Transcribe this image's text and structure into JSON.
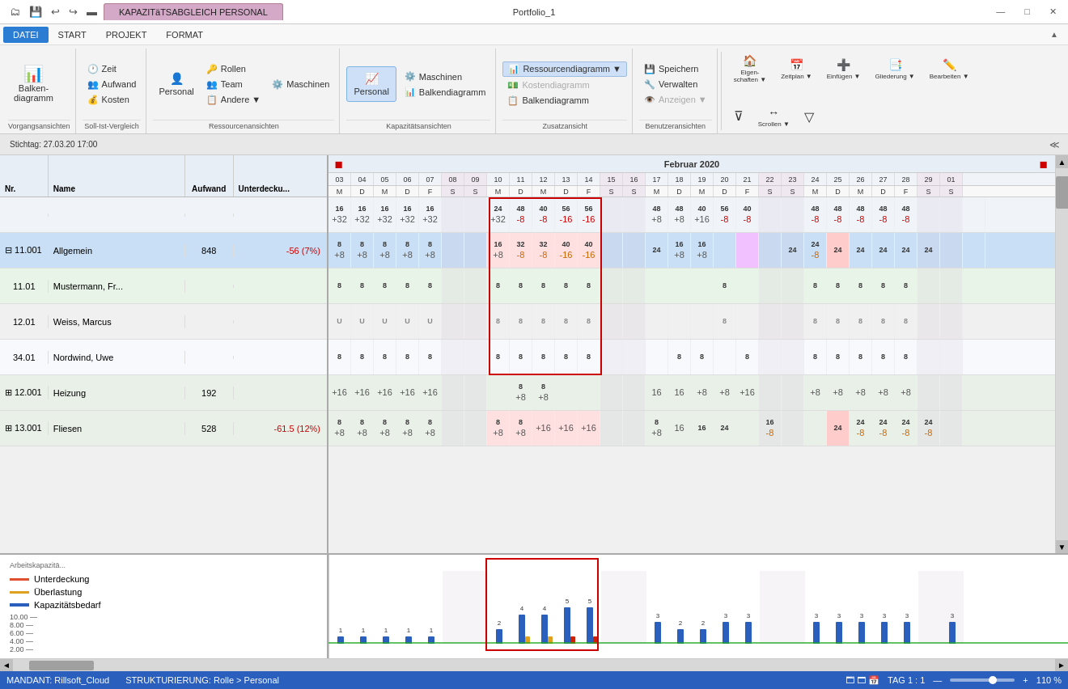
{
  "window": {
    "title": "Portfolio_1",
    "tab_label": "KAPAZITäTSABGLEICH PERSONAL",
    "min": "—",
    "max": "□",
    "close": "✕"
  },
  "menu": {
    "items": [
      "DATEI",
      "START",
      "PROJEKT",
      "FORMAT"
    ]
  },
  "ribbon": {
    "groups": [
      {
        "label": "Vorgangsansichten",
        "buttons": [
          {
            "icon": "📊",
            "label": "Balkendiagramm"
          }
        ]
      },
      {
        "label": "Soll-Ist-Vergleich",
        "buttons": [
          {
            "icon": "🕐",
            "label": "Zeit"
          },
          {
            "icon": "👥",
            "label": "Aufwand"
          },
          {
            "icon": "💰",
            "label": "Kosten"
          }
        ]
      },
      {
        "label": "Ressourcenansichten",
        "buttons": [
          {
            "icon": "👤",
            "label": "Personal"
          },
          {
            "icon": "🔧",
            "label": "Rollen"
          },
          {
            "icon": "👨‍👩‍👧",
            "label": "Team"
          },
          {
            "icon": "⚙️",
            "label": "Maschinen"
          },
          {
            "icon": "📋",
            "label": "Andere"
          }
        ]
      },
      {
        "label": "Kapazitätsansichten",
        "buttons": [
          {
            "icon": "📈",
            "label": "Personal",
            "active": true
          },
          {
            "icon": "📊",
            "label": "Maschinen"
          },
          {
            "icon": "📉",
            "label": "Balkendiagramm"
          }
        ]
      },
      {
        "label": "Zusatzansicht",
        "buttons": [
          {
            "icon": "📊",
            "label": "Ressourcendiagramm",
            "active": true
          },
          {
            "icon": "💵",
            "label": "Kostendiagramm"
          },
          {
            "icon": "📋",
            "label": "Balkendiagramm"
          }
        ]
      },
      {
        "label": "Benutzeransichten",
        "buttons": [
          {
            "icon": "💾",
            "label": "Speichern"
          },
          {
            "icon": "🔧",
            "label": "Verwalten"
          },
          {
            "icon": "👁️",
            "label": "Anzeigen"
          }
        ]
      }
    ],
    "actions": [
      {
        "icon": "🏠",
        "label": "Eigenschaften"
      },
      {
        "icon": "📅",
        "label": "Zeitplan"
      },
      {
        "icon": "➕",
        "label": "Einfügen"
      },
      {
        "icon": "📑",
        "label": "Gliederung"
      },
      {
        "icon": "✏️",
        "label": "Bearbeiten"
      },
      {
        "icon": "🔀",
        "label": "Scrollen"
      }
    ]
  },
  "gantt": {
    "stichtag": "Stichtag: 27.03.20 17:00",
    "month": "Februar 2020",
    "columns": {
      "nr": "Nr.",
      "name": "Name",
      "aufwand": "Aufwand",
      "deckung": "Unterdecku..."
    },
    "rows": [
      {
        "nr": "",
        "name": "",
        "aufwand": "",
        "deckung": "",
        "type": "cap-header",
        "values": [
          "16",
          "16",
          "16",
          "16",
          "16",
          "",
          "",
          "24",
          "48",
          "40",
          "56",
          "56",
          "",
          "",
          "48",
          "48",
          "40",
          "56",
          "40",
          "",
          "",
          "48",
          "48",
          "48",
          "48",
          "48",
          "",
          "",
          ""
        ],
        "sub_values": [
          "+32",
          "+32",
          "+32",
          "+32",
          "+32",
          "",
          "",
          "+32",
          "-8",
          "-8",
          "-16",
          "-16",
          "",
          "",
          "+8",
          "+8",
          "+16",
          "-8",
          "-8",
          "",
          "",
          "-8",
          "-8",
          "-8",
          "-8",
          "-8",
          "",
          "",
          ""
        ]
      },
      {
        "nr": "⊟ 11.001",
        "name": "Allgemein",
        "aufwand": "848",
        "deckung": "-56 (7%)",
        "deckung_neg": true,
        "type": "group",
        "values": [
          "8",
          "8",
          "8",
          "8",
          "8",
          "",
          "",
          "16",
          "32",
          "32",
          "40",
          "40",
          "",
          "",
          "24",
          "16",
          "16",
          "",
          "",
          "",
          "24",
          "24",
          "24",
          "24",
          "24",
          "24",
          "24",
          "",
          ""
        ],
        "sub_values": [
          "+8",
          "+8",
          "+8",
          "+8",
          "+8",
          "",
          "",
          "+8",
          "-8",
          "-8",
          "-16",
          "-16",
          "",
          "",
          "",
          "+8",
          "+8",
          "",
          "",
          "",
          "",
          "-8",
          "",
          "",
          "",
          "",
          "",
          "",
          ""
        ]
      },
      {
        "nr": "11.01",
        "name": "Mustermann, Fr...",
        "aufwand": "",
        "deckung": "",
        "type": "normal",
        "values": [
          "8",
          "8",
          "8",
          "8",
          "8",
          "",
          "",
          "8",
          "8",
          "8",
          "8",
          "8",
          "",
          "",
          "",
          "",
          "",
          "8",
          "",
          "",
          "",
          "8",
          "8",
          "8",
          "8",
          "8",
          "",
          ""
        ],
        "sub_values": []
      },
      {
        "nr": "12.01",
        "name": "Weiss, Marcus",
        "aufwand": "",
        "deckung": "",
        "type": "vacation",
        "values": [
          "U",
          "U",
          "U",
          "U",
          "U",
          "",
          "",
          "8",
          "8",
          "8",
          "8",
          "8",
          "",
          "",
          "",
          "",
          "",
          "8",
          "",
          "",
          "",
          "8",
          "8",
          "8",
          "8",
          "8",
          "",
          ""
        ],
        "sub_values": []
      },
      {
        "nr": "34.01",
        "name": "Nordwind, Uwe",
        "aufwand": "",
        "deckung": "",
        "type": "normal",
        "values": [
          "8",
          "8",
          "8",
          "8",
          "8",
          "",
          "",
          "8",
          "8",
          "8",
          "8",
          "8",
          "",
          "",
          "",
          "8",
          "8",
          "",
          "8",
          "",
          "",
          "8",
          "8",
          "8",
          "8",
          "8",
          "",
          ""
        ],
        "sub_values": []
      },
      {
        "nr": "⊞ 12.001",
        "name": "Heizung",
        "aufwand": "192",
        "deckung": "",
        "type": "group",
        "values": [
          "",
          "",
          "",
          "",
          "",
          "",
          "",
          "",
          "8",
          "8",
          "",
          "",
          "",
          "",
          "",
          "",
          "",
          "",
          "",
          "",
          "",
          "",
          "",
          "",
          "",
          "",
          "",
          "",
          ""
        ],
        "sub_values": [
          "+16",
          "+16",
          "+16",
          "+16",
          "+16",
          "",
          "",
          "",
          "+8",
          "+8",
          "",
          "",
          "",
          "",
          "16",
          "16",
          "+8",
          "+8",
          "+16",
          "",
          "",
          "+8",
          "+8",
          "+8",
          "+8",
          "+8",
          "",
          "",
          ""
        ]
      },
      {
        "nr": "⊞ 13.001",
        "name": "Fliesen",
        "aufwand": "528",
        "deckung": "-61.5 (12%)",
        "deckung_neg": true,
        "type": "group",
        "values": [
          "8",
          "8",
          "8",
          "8",
          "8",
          "",
          "",
          "8",
          "8",
          "",
          "",
          "",
          "",
          "",
          "8",
          "",
          "16",
          "24",
          "",
          "16",
          "",
          "",
          "24",
          "24",
          "24",
          "24",
          "24",
          "",
          ""
        ],
        "sub_values": [
          "+8",
          "+8",
          "+8",
          "+8",
          "+8",
          "",
          "",
          "+8",
          "+8",
          "+16",
          "+16",
          "+16",
          "",
          "",
          "+8",
          "16",
          "",
          "",
          "",
          "-8",
          "",
          "",
          "",
          "-8",
          "-8",
          "-8",
          "-8",
          "",
          ""
        ]
      }
    ],
    "days": [
      "03",
      "04",
      "05",
      "06",
      "07",
      "08",
      "09",
      "10",
      "11",
      "12",
      "13",
      "14",
      "15",
      "16",
      "17",
      "18",
      "19",
      "20",
      "21",
      "22",
      "23",
      "24",
      "25",
      "26",
      "27",
      "28",
      "29",
      "01"
    ],
    "weekdays": [
      "M",
      "D",
      "M",
      "D",
      "F",
      "S",
      "S",
      "M",
      "D",
      "M",
      "D",
      "F",
      "S",
      "S",
      "M",
      "D",
      "M",
      "D",
      "F",
      "S",
      "S",
      "M",
      "D",
      "M",
      "D",
      "F",
      "S",
      "S"
    ]
  },
  "chart": {
    "y_labels": [
      "10.00",
      "8.00",
      "6.00",
      "4.00",
      "2.00"
    ],
    "legend": [
      {
        "color": "#e05030",
        "label": "Unterdeckung"
      },
      {
        "color": "#e0a020",
        "label": "Überlastung"
      },
      {
        "color": "#2b5fbe",
        "label": "Kapazitätsbedarf"
      }
    ],
    "bars": [
      {
        "day": "03",
        "cap": 1,
        "over": 0,
        "under": 0
      },
      {
        "day": "04",
        "cap": 1,
        "over": 0,
        "under": 0
      },
      {
        "day": "05",
        "cap": 1,
        "over": 0,
        "under": 0
      },
      {
        "day": "06",
        "cap": 1,
        "over": 0,
        "under": 0
      },
      {
        "day": "07",
        "cap": 1,
        "over": 0,
        "under": 0
      },
      {
        "day": "08",
        "cap": 0,
        "over": 0,
        "under": 0
      },
      {
        "day": "09",
        "cap": 0,
        "over": 0,
        "under": 0
      },
      {
        "day": "10",
        "cap": 2,
        "over": 0,
        "under": 0
      },
      {
        "day": "11",
        "cap": 4,
        "over": 1,
        "under": 0
      },
      {
        "day": "12",
        "cap": 4,
        "over": 1,
        "under": 0
      },
      {
        "day": "13",
        "cap": 5,
        "over": 0,
        "under": 1
      },
      {
        "day": "14",
        "cap": 5,
        "over": 0,
        "under": 1
      },
      {
        "day": "15",
        "cap": 0,
        "over": 0,
        "under": 0
      },
      {
        "day": "16",
        "cap": 0,
        "over": 0,
        "under": 0
      },
      {
        "day": "17",
        "cap": 3,
        "over": 0,
        "under": 0
      },
      {
        "day": "18",
        "cap": 2,
        "over": 0,
        "under": 0
      },
      {
        "day": "19",
        "cap": 2,
        "over": 0,
        "under": 0
      },
      {
        "day": "20",
        "cap": 3,
        "over": 0,
        "under": 0
      },
      {
        "day": "21",
        "cap": 3,
        "over": 0,
        "under": 0
      },
      {
        "day": "22",
        "cap": 0,
        "over": 0,
        "under": 0
      },
      {
        "day": "23",
        "cap": 0,
        "over": 0,
        "under": 0
      },
      {
        "day": "24",
        "cap": 3,
        "over": 0,
        "under": 0
      },
      {
        "day": "25",
        "cap": 3,
        "over": 0,
        "under": 0
      },
      {
        "day": "26",
        "cap": 3,
        "over": 0,
        "under": 0
      },
      {
        "day": "27",
        "cap": 3,
        "over": 0,
        "under": 0
      },
      {
        "day": "28",
        "cap": 3,
        "over": 0,
        "under": 0
      },
      {
        "day": "29",
        "cap": 0,
        "over": 0,
        "under": 0
      },
      {
        "day": "01",
        "cap": 3,
        "over": 0,
        "under": 0
      }
    ]
  },
  "status": {
    "mandant": "MANDANT: Rillsoft_Cloud",
    "strukturierung": "STRUKTURIERUNG: Rolle > Personal",
    "tag": "TAG 1 : 1",
    "zoom": "110 %"
  },
  "properties_bar": "Eigenschaften"
}
